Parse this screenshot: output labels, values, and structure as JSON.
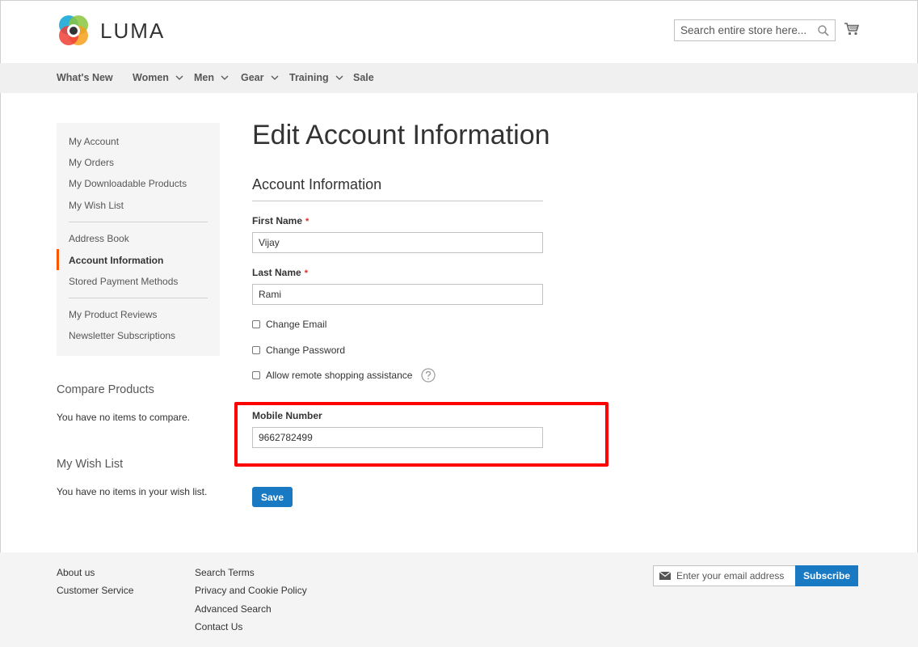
{
  "header": {
    "logo_text": "LUMA",
    "search_placeholder": "Search entire store here..."
  },
  "nav": {
    "items": [
      {
        "label": "What's New",
        "has_dropdown": false
      },
      {
        "label": "Women",
        "has_dropdown": true
      },
      {
        "label": "Men",
        "has_dropdown": true
      },
      {
        "label": "Gear",
        "has_dropdown": true
      },
      {
        "label": "Training",
        "has_dropdown": true
      },
      {
        "label": "Sale",
        "has_dropdown": false
      }
    ]
  },
  "sidebar": {
    "items": [
      {
        "label": "My Account",
        "active": false
      },
      {
        "label": "My Orders",
        "active": false
      },
      {
        "label": "My Downloadable Products",
        "active": false
      },
      {
        "label": "My Wish List",
        "active": false
      },
      {
        "label": "Address Book",
        "active": false
      },
      {
        "label": "Account Information",
        "active": true
      },
      {
        "label": "Stored Payment Methods",
        "active": false
      },
      {
        "label": "My Product Reviews",
        "active": false
      },
      {
        "label": "Newsletter Subscriptions",
        "active": false
      }
    ],
    "active_color": "#ff5501"
  },
  "compare": {
    "title": "Compare Products",
    "text": "You have no items to compare."
  },
  "wishlist": {
    "title": "My Wish List",
    "text": "You have no items in your wish list."
  },
  "main": {
    "page_title": "Edit Account Information",
    "legend": "Account Information",
    "first_name": {
      "label": "First Name",
      "required_mark": "*",
      "value": "Vijay"
    },
    "last_name": {
      "label": "Last Name",
      "required_mark": "*",
      "value": "Rami"
    },
    "checkboxes": [
      {
        "label": "Change Email",
        "checked": false
      },
      {
        "label": "Change Password",
        "checked": false
      },
      {
        "label": "Allow remote shopping assistance",
        "checked": false
      }
    ],
    "mobile": {
      "label": "Mobile Number",
      "value": "9662782499"
    },
    "save_label": "Save",
    "highlight_color": "#ff0000"
  },
  "footer": {
    "col1": [
      "About us",
      "Customer Service"
    ],
    "col2": [
      "Search Terms",
      "Privacy and Cookie Policy",
      "Advanced Search",
      "Contact Us"
    ],
    "newsletter_placeholder": "Enter your email address",
    "subscribe_label": "Subscribe"
  },
  "colors": {
    "primary": "#1979c3",
    "nav_bg": "#f0f0f0",
    "required": "#e02b27"
  }
}
